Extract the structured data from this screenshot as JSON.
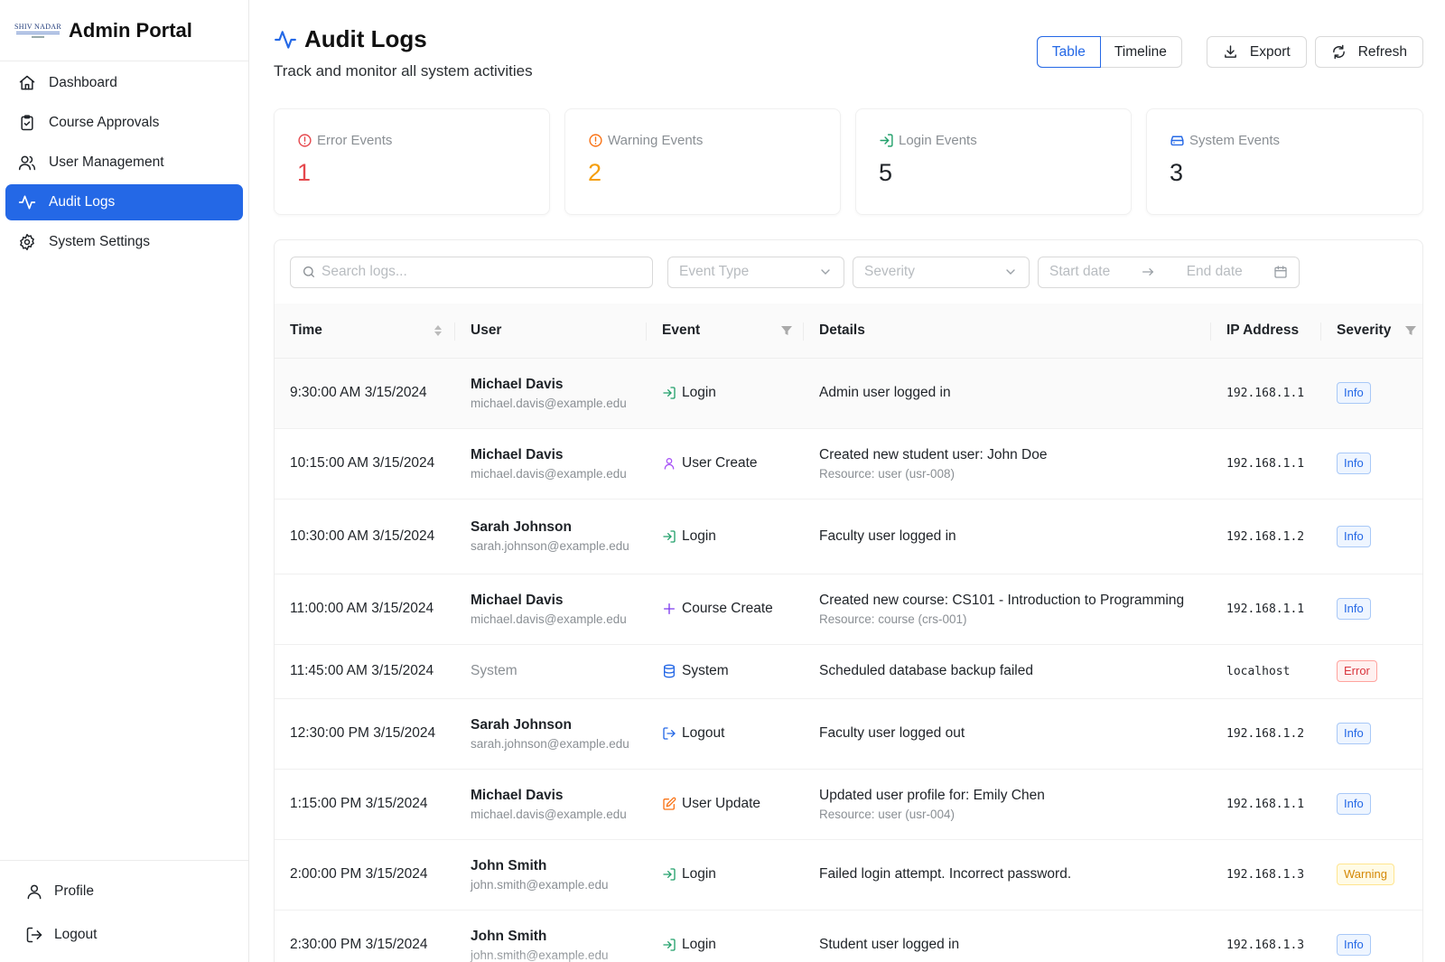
{
  "sidebar": {
    "logo_text": "SHIV NADAR",
    "title": "Admin Portal",
    "items": [
      {
        "label": "Dashboard",
        "icon": "home-icon"
      },
      {
        "label": "Course Approvals",
        "icon": "clipboard-check-icon"
      },
      {
        "label": "User Management",
        "icon": "users-icon"
      },
      {
        "label": "Audit Logs",
        "icon": "activity-icon",
        "active": true
      },
      {
        "label": "System Settings",
        "icon": "gear-icon"
      }
    ],
    "bottom": {
      "profile": "Profile",
      "logout": "Logout"
    }
  },
  "header": {
    "title": "Audit Logs",
    "subtitle": "Track and monitor all system activities"
  },
  "toolbar": {
    "view_table": "Table",
    "view_timeline": "Timeline",
    "export": "Export",
    "refresh": "Refresh",
    "active_view": "Table"
  },
  "stats": [
    {
      "label": "Error Events",
      "value": "1",
      "color": "#e5484d"
    },
    {
      "label": "Warning Events",
      "value": "2",
      "color": "#f59e0b"
    },
    {
      "label": "Login Events",
      "value": "5",
      "color": "#1f2328"
    },
    {
      "label": "System Events",
      "value": "3",
      "color": "#1f2328"
    }
  ],
  "filters": {
    "search_placeholder": "Search logs...",
    "event_type_placeholder": "Event Type",
    "severity_placeholder": "Severity",
    "start_date": "Start date",
    "end_date": "End date"
  },
  "table": {
    "columns": [
      "Time",
      "User",
      "Event",
      "Details",
      "IP Address",
      "Severity"
    ],
    "rows": [
      {
        "time": "9:30:00 AM 3/15/2024",
        "user": "Michael Davis",
        "email": "michael.davis@example.edu",
        "event": "Login",
        "event_icon": "login-icon",
        "details": "Admin user logged in",
        "resource": "",
        "ip": "192.168.1.1",
        "severity": "Info"
      },
      {
        "time": "10:15:00 AM 3/15/2024",
        "user": "Michael Davis",
        "email": "michael.davis@example.edu",
        "event": "User Create",
        "event_icon": "user-icon",
        "details": "Created new student user: John Doe",
        "resource": "Resource: user (usr-008)",
        "ip": "192.168.1.1",
        "severity": "Info"
      },
      {
        "time": "10:30:00 AM 3/15/2024",
        "user": "Sarah Johnson",
        "email": "sarah.johnson@example.edu",
        "event": "Login",
        "event_icon": "login-icon",
        "details": "Faculty user logged in",
        "resource": "",
        "ip": "192.168.1.2",
        "severity": "Info"
      },
      {
        "time": "11:00:00 AM 3/15/2024",
        "user": "Michael Davis",
        "email": "michael.davis@example.edu",
        "event": "Course Create",
        "event_icon": "plus-icon",
        "details": "Created new course: CS101 - Introduction to Programming",
        "resource": "Resource: course (crs-001)",
        "ip": "192.168.1.1",
        "severity": "Info"
      },
      {
        "time": "11:45:00 AM 3/15/2024",
        "user": "System",
        "email": "",
        "event": "System",
        "event_icon": "database-icon",
        "details": "Scheduled database backup failed",
        "resource": "",
        "ip": "localhost",
        "severity": "Error"
      },
      {
        "time": "12:30:00 PM 3/15/2024",
        "user": "Sarah Johnson",
        "email": "sarah.johnson@example.edu",
        "event": "Logout",
        "event_icon": "logout-icon",
        "details": "Faculty user logged out",
        "resource": "",
        "ip": "192.168.1.2",
        "severity": "Info"
      },
      {
        "time": "1:15:00 PM 3/15/2024",
        "user": "Michael Davis",
        "email": "michael.davis@example.edu",
        "event": "User Update",
        "event_icon": "edit-icon",
        "details": "Updated user profile for: Emily Chen",
        "resource": "Resource: user (usr-004)",
        "ip": "192.168.1.1",
        "severity": "Info"
      },
      {
        "time": "2:00:00 PM 3/15/2024",
        "user": "John Smith",
        "email": "john.smith@example.edu",
        "event": "Login",
        "event_icon": "login-icon",
        "details": "Failed login attempt. Incorrect password.",
        "resource": "",
        "ip": "192.168.1.3",
        "severity": "Warning"
      },
      {
        "time": "2:30:00 PM 3/15/2024",
        "user": "John Smith",
        "email": "john.smith@example.edu",
        "event": "Login",
        "event_icon": "login-icon",
        "details": "Student user logged in",
        "resource": "",
        "ip": "192.168.1.3",
        "severity": "Info"
      }
    ]
  },
  "colors": {
    "accent": "#2468e6",
    "error": "#e5484d",
    "warning": "#f59e0b",
    "login": "#22a06b",
    "user_create": "#a855f7",
    "course_create": "#7c3aed",
    "system": "#2468e6",
    "user_update": "#f97316"
  }
}
